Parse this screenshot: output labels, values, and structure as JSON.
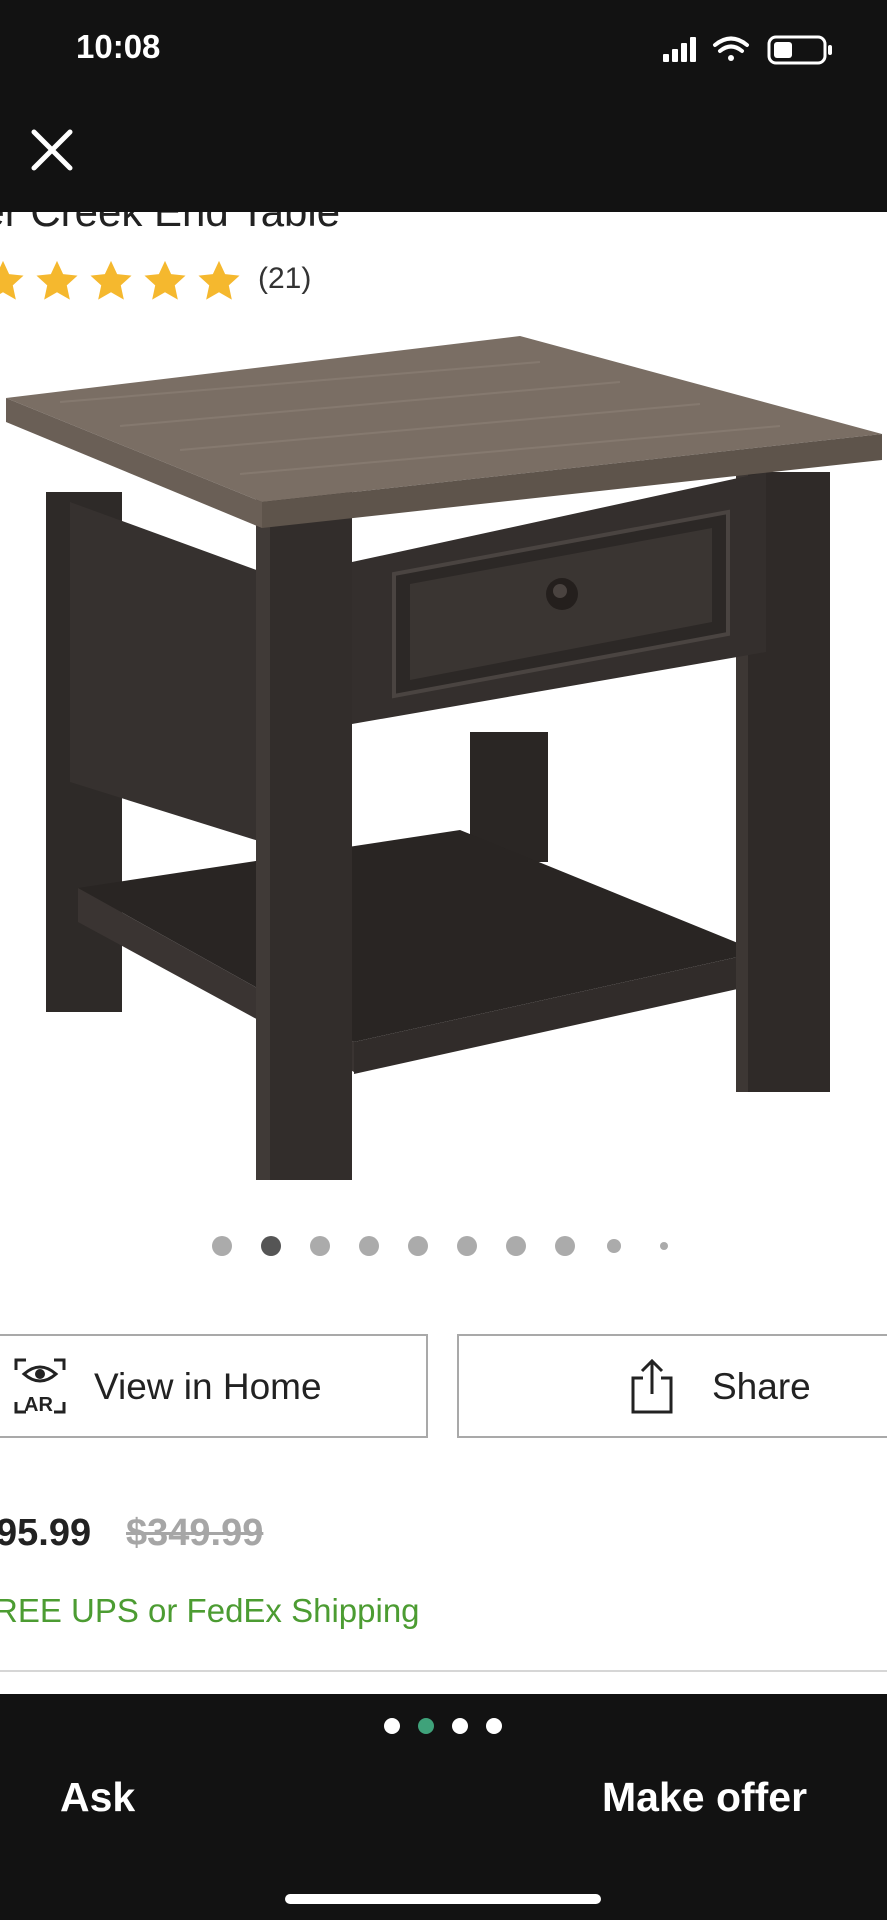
{
  "status": {
    "time": "10:08"
  },
  "product": {
    "title": "ler Creek End Table",
    "rating": 5,
    "review_count": "(21)",
    "image_count": 10,
    "current_image": 2
  },
  "buttons": {
    "view_in_home": "View in Home",
    "ar_badge": "AR",
    "share": "Share"
  },
  "pricing": {
    "price": "95.99",
    "original_price": "$349.99",
    "shipping": "REE UPS or FedEx Shipping"
  },
  "bottom": {
    "pages": 4,
    "active_page": 2,
    "ask": "Ask",
    "make_offer": "Make offer"
  },
  "colors": {
    "accent_green": "#4c9c32",
    "pager_active": "#3fa27a",
    "star": "#f5b82e",
    "dark_bar": "#121212"
  }
}
